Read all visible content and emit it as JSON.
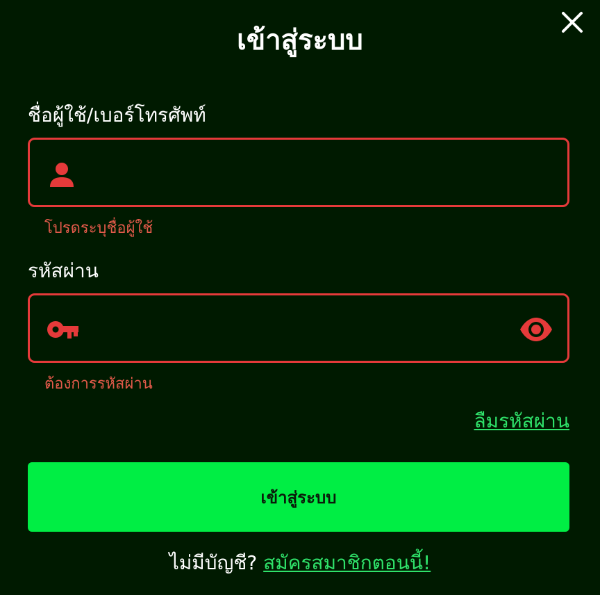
{
  "dialog": {
    "title": "เข้าสู่ระบบ",
    "close_icon": "close-icon"
  },
  "username": {
    "label": "ชื่อผู้ใช้/เบอร์โทรศัพท์",
    "value": "",
    "placeholder": "",
    "icon": "user-icon",
    "error": "โปรดระบุชื่อผู้ใช้"
  },
  "password": {
    "label": "รหัสผ่าน",
    "value": "",
    "placeholder": "",
    "icon": "key-icon",
    "toggle_icon": "eye-icon",
    "error": "ต้องการรหัสผ่าน"
  },
  "forgot_password": "ลืมรหัสผ่าน",
  "submit_label": "เข้าสู่ระบบ",
  "signup": {
    "prompt": "ไม่มีบัญชี?",
    "link": "สมัครสมาชิกตอนนี้!"
  },
  "colors": {
    "background": "#001a00",
    "error": "#e53a3a",
    "accent": "#00ee44",
    "link": "#2fe26a"
  }
}
